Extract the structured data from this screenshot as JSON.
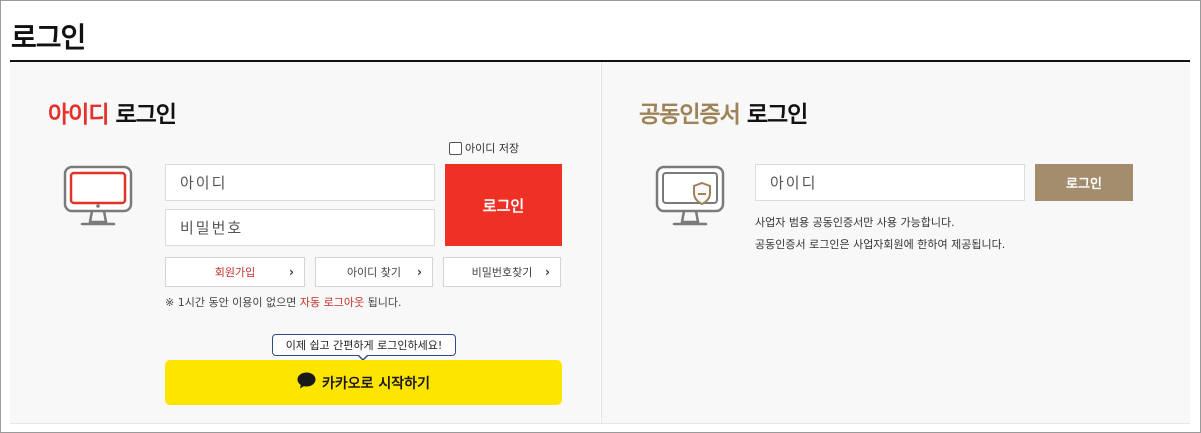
{
  "page": {
    "title": "로그인"
  },
  "id_login": {
    "title_accent": "아이디",
    "title_rest": " 로그인",
    "save_id_label": "아이디 저장",
    "id_placeholder": "아이디",
    "pw_placeholder": "비밀번호",
    "login_button": "로그인",
    "links": {
      "signup": "회원가입",
      "find_id": "아이디 찾기",
      "find_pw": "비밀번호찾기"
    },
    "notice_prefix": "※ 1시간 동안 이용이 없으면 ",
    "notice_highlight": "자동 로그아웃",
    "notice_suffix": " 됩니다.",
    "kakao_tooltip": "이제 쉽고 간편하게 로그인하세요!",
    "kakao_button": "카카오로 시작하기"
  },
  "cert_login": {
    "title_accent": "공동인증서",
    "title_rest": " 로그인",
    "id_placeholder": "아이디",
    "login_button": "로그인",
    "desc_line1": "사업자 범용 공동인증서만 사용 가능합니다.",
    "desc_line2": "공동인증서 로그인은 사업자회원에 한하여 제공됩니다."
  },
  "icons": {
    "monitor": "monitor-icon",
    "monitor_shield": "monitor-shield-icon",
    "chevron": "chevron-right-icon",
    "chat": "chat-bubble-icon"
  },
  "colors": {
    "accent_red": "#e3312b",
    "login_red": "#ef3025",
    "accent_gold": "#9e8359",
    "login_gold": "#a38d6d",
    "kakao_yellow": "#fee500",
    "tooltip_border": "#2f4a86"
  }
}
